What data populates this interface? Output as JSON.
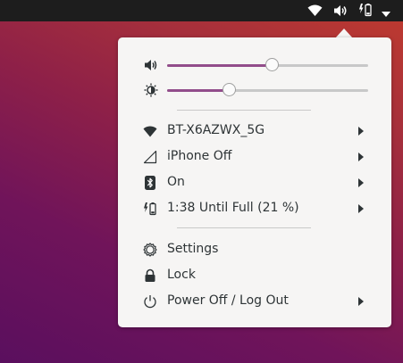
{
  "topbar": {
    "icons": [
      "wifi-icon",
      "volume-icon",
      "battery-charging-icon",
      "menu-down-icon"
    ]
  },
  "menu": {
    "volume": {
      "icon": "volume-icon",
      "level": 0.52
    },
    "brightness": {
      "icon": "brightness-icon",
      "level": 0.31
    },
    "network_items": [
      {
        "icon": "wifi-icon",
        "label": "BT-X6AZWX_5G",
        "submenu": true
      },
      {
        "icon": "cellular-signal-icon",
        "label": "iPhone Off",
        "submenu": true
      },
      {
        "icon": "bluetooth-icon",
        "label": "On",
        "submenu": true
      },
      {
        "icon": "battery-charging-icon",
        "label": "1:38 Until Full (21 %)",
        "submenu": true
      }
    ],
    "system_items": [
      {
        "icon": "settings-icon",
        "label": "Settings",
        "submenu": false
      },
      {
        "icon": "lock-icon",
        "label": "Lock",
        "submenu": false
      },
      {
        "icon": "power-icon",
        "label": "Power Off / Log Out",
        "submenu": true
      }
    ]
  },
  "colors": {
    "accent": "#924d8b",
    "menu_bg": "#f6f5f4",
    "text": "#2e3436",
    "topbar": "#1d1d1d"
  }
}
